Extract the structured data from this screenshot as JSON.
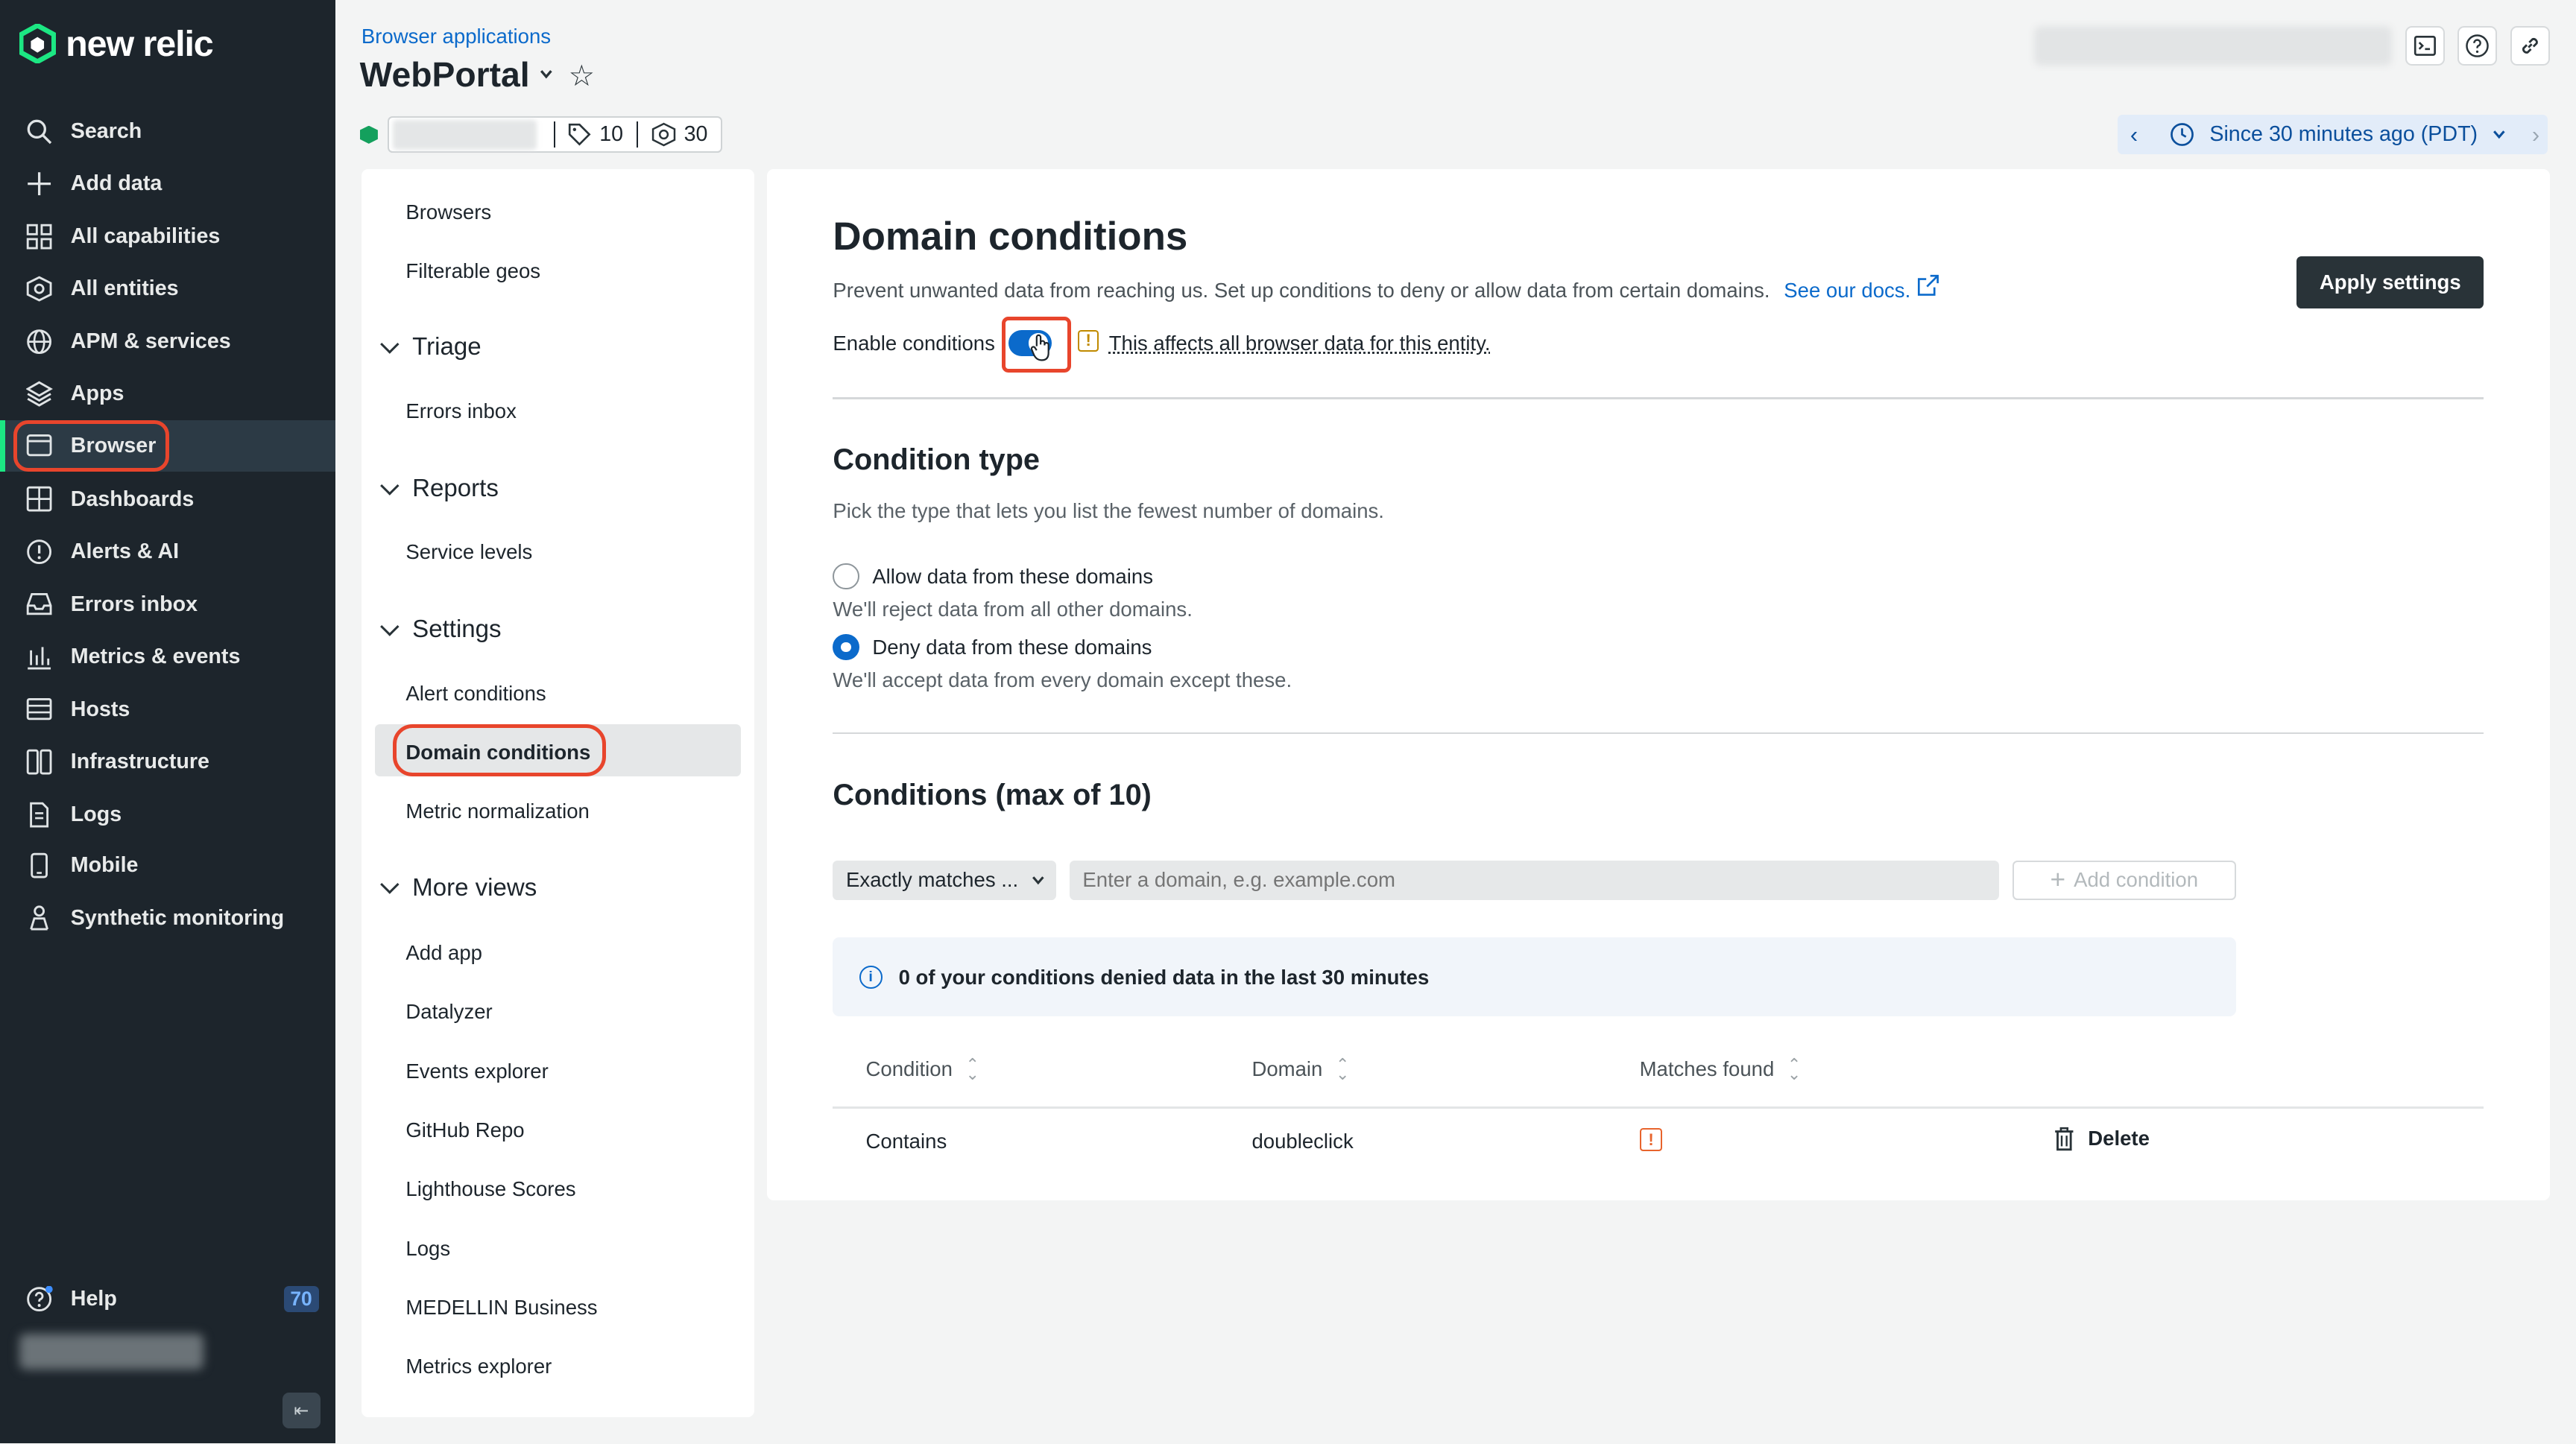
{
  "brand": {
    "name": "new relic",
    "accent": "#1ce783"
  },
  "nav": {
    "items": [
      {
        "label": "Search",
        "icon": "search-icon"
      },
      {
        "label": "Add data",
        "icon": "plus-icon"
      },
      {
        "label": "All capabilities",
        "icon": "grid-icon"
      },
      {
        "label": "All entities",
        "icon": "entities-icon"
      },
      {
        "label": "APM & services",
        "icon": "globe-icon"
      },
      {
        "label": "Apps",
        "icon": "layers-icon"
      },
      {
        "label": "Browser",
        "icon": "browser-icon",
        "active": true
      },
      {
        "label": "Dashboards",
        "icon": "dashboard-icon"
      },
      {
        "label": "Alerts & AI",
        "icon": "alert-icon"
      },
      {
        "label": "Errors inbox",
        "icon": "inbox-icon"
      },
      {
        "label": "Metrics & events",
        "icon": "bar-chart-icon"
      },
      {
        "label": "Hosts",
        "icon": "hosts-icon"
      },
      {
        "label": "Infrastructure",
        "icon": "infrastructure-icon"
      },
      {
        "label": "Logs",
        "icon": "logs-icon"
      },
      {
        "label": "Mobile",
        "icon": "mobile-icon"
      },
      {
        "label": "Synthetic monitoring",
        "icon": "synthetic-icon"
      }
    ],
    "help_label": "Help",
    "help_badge": "70"
  },
  "header": {
    "breadcrumb": "Browser applications",
    "title": "WebPortal",
    "tags_count": "10",
    "related_count": "30",
    "time_range": "Since 30 minutes ago (PDT)"
  },
  "subnav": {
    "top_items": [
      "Browsers",
      "Filterable geos"
    ],
    "groups": [
      {
        "label": "Triage",
        "items": [
          "Errors inbox"
        ]
      },
      {
        "label": "Reports",
        "items": [
          "Service levels"
        ]
      },
      {
        "label": "Settings",
        "items": [
          "Alert conditions",
          "Domain conditions",
          "Metric normalization"
        ]
      },
      {
        "label": "More views",
        "items": [
          "Add app",
          "Datalyzer",
          "Events explorer",
          "GitHub Repo",
          "Lighthouse Scores",
          "Logs",
          "MEDELLIN Business",
          "Metrics explorer"
        ]
      }
    ],
    "selected": "Domain conditions"
  },
  "main": {
    "title": "Domain conditions",
    "description": "Prevent unwanted data from reaching us. Set up conditions to deny or allow data from certain domains.",
    "docs_link": "See our docs.",
    "apply_button": "Apply settings",
    "enable_label": "Enable conditions",
    "enable_on": true,
    "warning": "This affects all browser data for this entity.",
    "condition_type": {
      "title": "Condition type",
      "subtitle": "Pick the type that lets you list the fewest number of domains.",
      "options": [
        {
          "label": "Allow data from these domains",
          "help": "We'll reject data from all other domains.",
          "selected": false
        },
        {
          "label": "Deny data from these domains",
          "help": "We'll accept data from every domain except these.",
          "selected": true
        }
      ]
    },
    "conditions": {
      "title": "Conditions (max of 10)",
      "match_select": "Exactly matches ...",
      "domain_placeholder": "Enter a domain, e.g. example.com",
      "add_button": "Add condition",
      "info": "0 of your conditions denied data in the last 30 minutes",
      "columns": [
        "Condition",
        "Domain",
        "Matches found"
      ],
      "rows": [
        {
          "condition": "Contains",
          "domain": "doubleclick",
          "delete_label": "Delete"
        }
      ]
    }
  }
}
